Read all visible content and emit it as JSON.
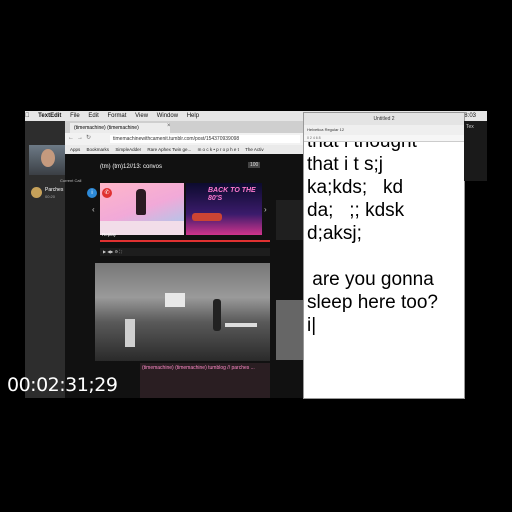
{
  "menubar": {
    "apple": "",
    "app": "TextEdit",
    "items": [
      "File",
      "Edit",
      "Format",
      "View",
      "Window",
      "Help"
    ],
    "clock": "Wed Feb 22  17:18:03"
  },
  "call": {
    "label": "Current Call",
    "caller": "Parches",
    "duration": "00:20"
  },
  "browser": {
    "tab_title": "(timemachine) (timemachine)",
    "url": "timemachinewithcamenit.tumblr.com/post/154370939098",
    "bookmarks": [
      "Apps",
      "Bookmarks",
      "SimpleAdder",
      "Rare Aphex Twin ge...",
      "m o c k • p r o p h e t",
      "The Activ"
    ]
  },
  "post": {
    "title": "(tm) (tm)12//13: convos",
    "likes": "100",
    "video2_title": "BACK TO THE 80'S",
    "replay_label": "Replay",
    "bottom_caption": "(timemachine) (timemachine) tumblog // parches ..."
  },
  "textedit": {
    "title": "Untitled 2",
    "toolbar": "Helvetica    Regular    12",
    "ruler": "0     2     4     6     8",
    "lines": [
      "that i thought",
      "that i t s;j",
      "ka;kds;   kd",
      "da;   ;; kdsk",
      "d;aksj;",
      "",
      " are you gonna",
      "sleep here too?",
      "i"
    ],
    "right_edge": "Tex"
  },
  "overlay": {
    "timecode": "00:02:31;29"
  },
  "colors": {
    "accent_red": "#e03131",
    "accent_blue": "#2d8ad8",
    "menubar_bg": "#e6e6e6"
  }
}
